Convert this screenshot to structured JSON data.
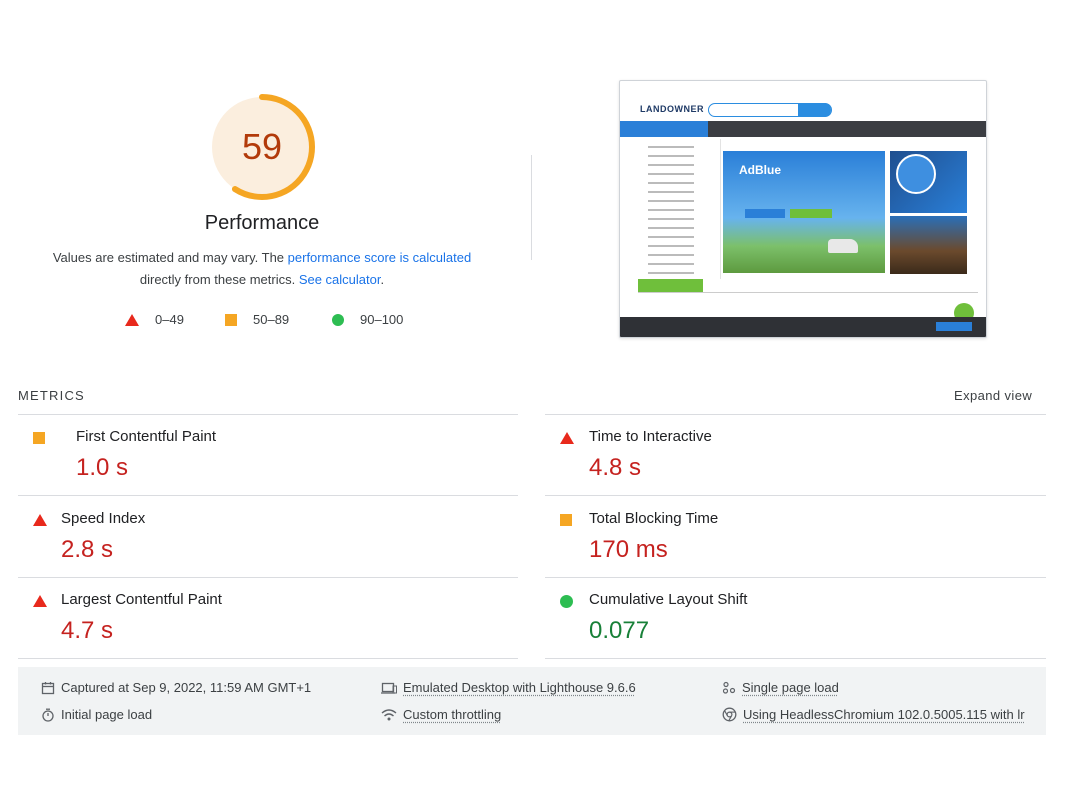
{
  "performance": {
    "score": "59",
    "score_fraction": 0.59,
    "title": "Performance",
    "desc_prefix": "Values are estimated and may vary. The ",
    "desc_link1": "performance score is calculated",
    "desc_middle": " directly from these metrics. ",
    "desc_link2": "See calculator",
    "desc_suffix": ".",
    "colors": {
      "ring": "#f5a623",
      "ring_bg": "#fbeede",
      "score_text": "#b23a0a"
    }
  },
  "legend": [
    {
      "range": "0–49",
      "shape": "triangle",
      "color": "#e8291c"
    },
    {
      "range": "50–89",
      "shape": "square",
      "color": "#f5a623"
    },
    {
      "range": "90–100",
      "shape": "circle",
      "color": "#2dbd52"
    }
  ],
  "thumbnail": {
    "logo": "LANDOWNER",
    "hero_title": "AdBlue"
  },
  "metrics": {
    "title": "METRICS",
    "expand": "Expand view",
    "items": [
      {
        "label": "First Contentful Paint",
        "value": "1.0 s",
        "rating": "average"
      },
      {
        "label": "Time to Interactive",
        "value": "4.8 s",
        "rating": "fail"
      },
      {
        "label": "Speed Index",
        "value": "2.8 s",
        "rating": "fail"
      },
      {
        "label": "Total Blocking Time",
        "value": "170 ms",
        "rating": "average"
      },
      {
        "label": "Largest Contentful Paint",
        "value": "4.7 s",
        "rating": "fail"
      },
      {
        "label": "Cumulative Layout Shift",
        "value": "0.077",
        "rating": "pass"
      }
    ]
  },
  "footer": {
    "captured": "Captured at Sep 9, 2022, 11:59 AM GMT+1",
    "emulated": "Emulated Desktop with Lighthouse 9.6.6",
    "single": "Single page load",
    "initial": "Initial page load",
    "throttling": "Custom throttling",
    "using": "Using HeadlessChromium 102.0.5005.115 with lr"
  }
}
